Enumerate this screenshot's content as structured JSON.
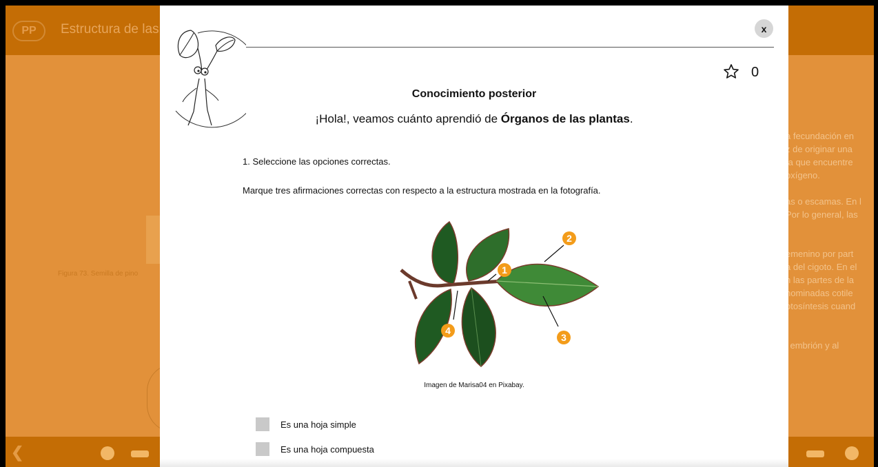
{
  "background_app": {
    "logo": "PP",
    "title": "Estructura de las",
    "figure_caption": "Figura 73. Semilla de pino",
    "right_text_lines": [
      "a fecundación en",
      "z de originar una",
      "ta que encuentre",
      "oxígeno.",
      "",
      "as o escamas. En l",
      "Por lo general, las",
      "",
      "",
      "emenino por part",
      "a del cigoto. En el",
      "n las partes de la",
      "nominadas cotile",
      "otosíntesis cuand",
      "",
      "",
      "l embrión y al"
    ]
  },
  "modal": {
    "close_label": "x",
    "star_count": "0",
    "heading": "Conocimiento posterior",
    "greeting_prefix": "¡Hola!, veamos cuánto aprendió de ",
    "greeting_topic": "Órganos de las plantas",
    "greeting_suffix": ".",
    "question": "1. Seleccione las opciones correctas.",
    "instruction": "Marque tres afirmaciones correctas con respecto a la estructura mostrada en la fotografía.",
    "photo_markers": [
      "1",
      "2",
      "3",
      "4"
    ],
    "photo_credit": "Imagen de Marisa04 en Pixabay.",
    "options": [
      {
        "label": "Es una hoja simple"
      },
      {
        "label": "Es una hoja compuesta"
      }
    ]
  },
  "colors": {
    "background": "#e2913a",
    "header": "#c46d05",
    "marker": "#f39c1a"
  }
}
